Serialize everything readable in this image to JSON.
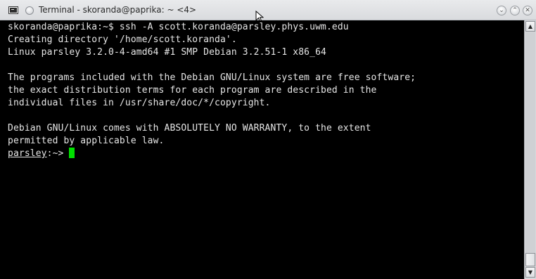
{
  "window": {
    "title": "Terminal - skoranda@paprika: ~ <4>",
    "minimize_glyph": "⌄",
    "maximize_glyph": "⌃",
    "close_glyph": "✕"
  },
  "terminal": {
    "lines": [
      "skoranda@paprika:~$ ssh -A scott.koranda@parsley.phys.uwm.edu",
      "Creating directory '/home/scott.koranda'.",
      "Linux parsley 3.2.0-4-amd64 #1 SMP Debian 3.2.51-1 x86_64",
      "",
      "The programs included with the Debian GNU/Linux system are free software;",
      "the exact distribution terms for each program are described in the",
      "individual files in /usr/share/doc/*/copyright.",
      "",
      "Debian GNU/Linux comes with ABSOLUTELY NO WARRANTY, to the extent",
      "permitted by applicable law."
    ],
    "prompt_host": "parsley",
    "prompt_suffix": ":~> ",
    "cursor_color": "#00e000",
    "text_color": "#e6e6e6",
    "background_color": "#000000"
  },
  "scrollbar": {
    "up_glyph": "▲",
    "down_glyph": "▼",
    "position": 1.0
  }
}
